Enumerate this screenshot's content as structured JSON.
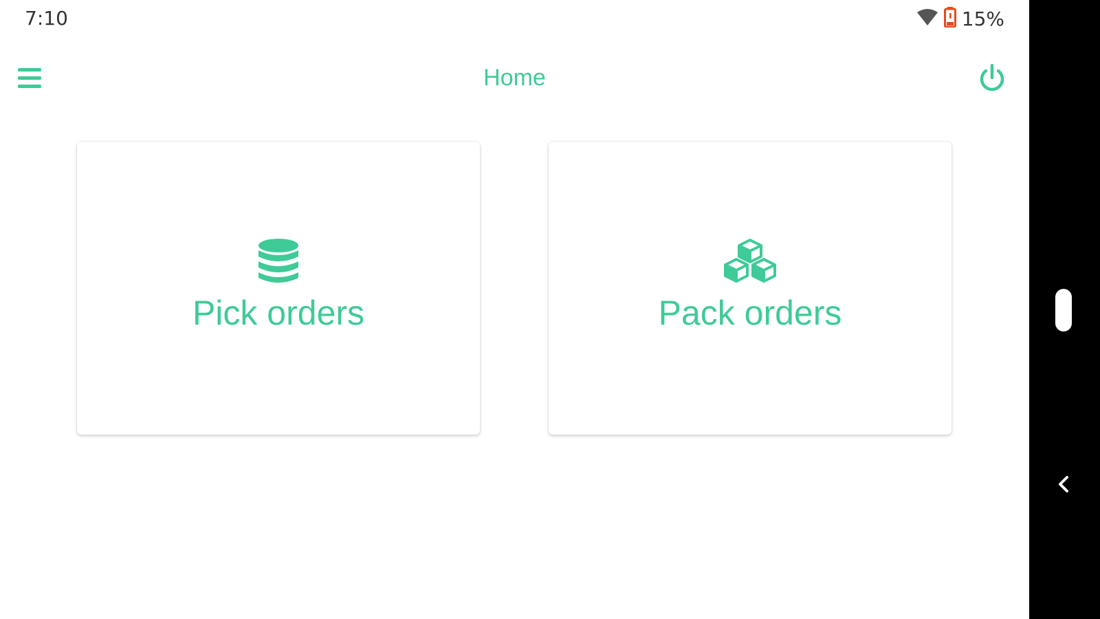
{
  "status_bar": {
    "time": "7:10",
    "battery": "15%",
    "icons": [
      "wifi-icon",
      "battery-low-icon"
    ]
  },
  "app_bar": {
    "title": "Home",
    "menu_icon": "menu-icon",
    "power_icon": "power-icon"
  },
  "cards": [
    {
      "label": "Pick orders",
      "icon": "database-icon"
    },
    {
      "label": "Pack orders",
      "icon": "cubes-icon"
    }
  ],
  "nav_bar": {
    "icons": [
      "home-handle",
      "back-icon"
    ]
  },
  "colors": {
    "accent": "#3ecb97",
    "battery_warning": "#e64a19",
    "nav_background": "#000000"
  }
}
